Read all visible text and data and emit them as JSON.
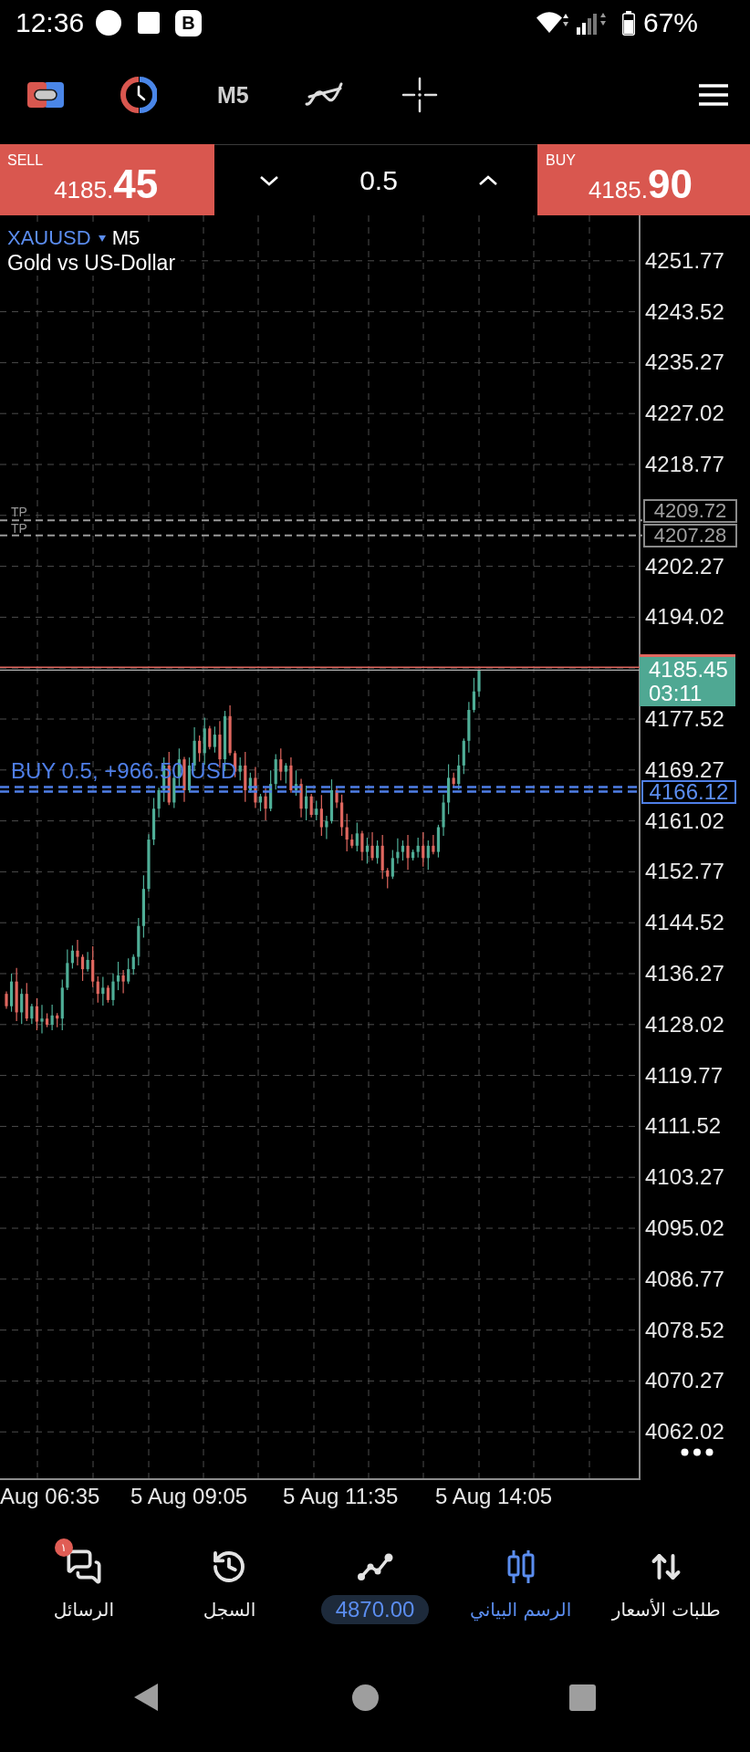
{
  "status_bar": {
    "time": "12:36",
    "app_icon": "B",
    "battery": "67%"
  },
  "toolbar": {
    "timeframe": "M5"
  },
  "trade_panel": {
    "sell": {
      "label": "SELL",
      "price": "4185.**45**"
    },
    "volume": "0.5",
    "buy": {
      "label": "BUY",
      "price": "4185.**90**"
    }
  },
  "chart": {
    "symbol": "XAUUSD",
    "timeframe": "M5",
    "description": "Gold vs US-Dollar",
    "price_axis": [
      "4251.77",
      "4243.52",
      "4235.27",
      "4227.02",
      "4218.77",
      "4202.27",
      "4194.02",
      "4177.52",
      "4169.27",
      "4161.02",
      "4152.77",
      "4144.52",
      "4136.27",
      "4128.02",
      "4119.77",
      "4111.52",
      "4103.27",
      "4095.02",
      "4086.77",
      "4078.52",
      "4070.27",
      "4062.02"
    ],
    "take_profit": [
      {
        "label": "TP",
        "price": "4209.72"
      },
      {
        "label": "TP",
        "price": "4207.28"
      }
    ],
    "current_price": {
      "price": "4185.45",
      "countdown": "03:11"
    },
    "position": {
      "label": "BUY 0.5, +966.50 USD",
      "price": "4166.12"
    },
    "time_axis": [
      "Aug 06:35",
      "5 Aug 09:05",
      "5 Aug 11:35",
      "5 Aug 14:05"
    ]
  },
  "bottom_nav": [
    {
      "kind": "tab",
      "label": "طلبات الأسعار",
      "selected": false
    },
    {
      "kind": "tab",
      "label": "الرسم البياني",
      "selected": true
    },
    {
      "kind": "balance",
      "label": "4870.00",
      "selected": false
    },
    {
      "kind": "tab",
      "label": "السجل",
      "selected": false
    },
    {
      "kind": "tab",
      "label": "الرسائل",
      "selected": false,
      "badge": "١"
    }
  ]
}
